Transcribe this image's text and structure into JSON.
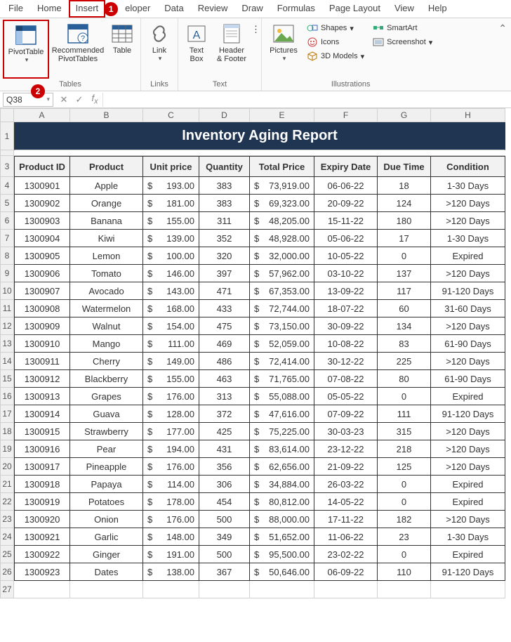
{
  "menu": [
    "File",
    "Home",
    "Insert",
    "Developer",
    "Data",
    "Review",
    "Draw",
    "Formulas",
    "Page Layout",
    "View",
    "Help"
  ],
  "active_menu_index": 2,
  "callouts": {
    "insert": "1",
    "pivot": "2"
  },
  "ribbon": {
    "pivot_table": "PivotTable",
    "recommended": "Recommended\nPivotTables",
    "table": "Table",
    "link": "Link",
    "text_box": "Text\nBox",
    "header_footer": "Header\n& Footer",
    "pictures": "Pictures",
    "shapes": "Shapes",
    "icons": "Icons",
    "models": "3D Models",
    "smartart": "SmartArt",
    "screenshot": "Screenshot",
    "g_tables": "Tables",
    "g_links": "Links",
    "g_text": "Text",
    "g_illust": "Illustrations"
  },
  "namebox": "Q38",
  "formula": "",
  "columns": [
    "A",
    "B",
    "C",
    "D",
    "E",
    "F",
    "G",
    "H"
  ],
  "title": "Inventory Aging Report",
  "headers": [
    "Product ID",
    "Product",
    "Unit price",
    "Quantity",
    "Total Price",
    "Expiry Date",
    "Due Time",
    "Condition"
  ],
  "rows": [
    {
      "id": "1300901",
      "prod": "Apple",
      "unit": "193.00",
      "qty": "383",
      "total": "73,919.00",
      "exp": "06-06-22",
      "due": "18",
      "cond": "1-30 Days"
    },
    {
      "id": "1300902",
      "prod": "Orange",
      "unit": "181.00",
      "qty": "383",
      "total": "69,323.00",
      "exp": "20-09-22",
      "due": "124",
      "cond": ">120 Days"
    },
    {
      "id": "1300903",
      "prod": "Banana",
      "unit": "155.00",
      "qty": "311",
      "total": "48,205.00",
      "exp": "15-11-22",
      "due": "180",
      "cond": ">120 Days"
    },
    {
      "id": "1300904",
      "prod": "Kiwi",
      "unit": "139.00",
      "qty": "352",
      "total": "48,928.00",
      "exp": "05-06-22",
      "due": "17",
      "cond": "1-30 Days"
    },
    {
      "id": "1300905",
      "prod": "Lemon",
      "unit": "100.00",
      "qty": "320",
      "total": "32,000.00",
      "exp": "10-05-22",
      "due": "0",
      "cond": "Expired"
    },
    {
      "id": "1300906",
      "prod": "Tomato",
      "unit": "146.00",
      "qty": "397",
      "total": "57,962.00",
      "exp": "03-10-22",
      "due": "137",
      "cond": ">120 Days"
    },
    {
      "id": "1300907",
      "prod": "Avocado",
      "unit": "143.00",
      "qty": "471",
      "total": "67,353.00",
      "exp": "13-09-22",
      "due": "117",
      "cond": "91-120 Days"
    },
    {
      "id": "1300908",
      "prod": "Watermelon",
      "unit": "168.00",
      "qty": "433",
      "total": "72,744.00",
      "exp": "18-07-22",
      "due": "60",
      "cond": "31-60 Days"
    },
    {
      "id": "1300909",
      "prod": "Walnut",
      "unit": "154.00",
      "qty": "475",
      "total": "73,150.00",
      "exp": "30-09-22",
      "due": "134",
      "cond": ">120 Days"
    },
    {
      "id": "1300910",
      "prod": "Mango",
      "unit": "111.00",
      "qty": "469",
      "total": "52,059.00",
      "exp": "10-08-22",
      "due": "83",
      "cond": "61-90 Days"
    },
    {
      "id": "1300911",
      "prod": "Cherry",
      "unit": "149.00",
      "qty": "486",
      "total": "72,414.00",
      "exp": "30-12-22",
      "due": "225",
      "cond": ">120 Days"
    },
    {
      "id": "1300912",
      "prod": "Blackberry",
      "unit": "155.00",
      "qty": "463",
      "total": "71,765.00",
      "exp": "07-08-22",
      "due": "80",
      "cond": "61-90 Days"
    },
    {
      "id": "1300913",
      "prod": "Grapes",
      "unit": "176.00",
      "qty": "313",
      "total": "55,088.00",
      "exp": "05-05-22",
      "due": "0",
      "cond": "Expired"
    },
    {
      "id": "1300914",
      "prod": "Guava",
      "unit": "128.00",
      "qty": "372",
      "total": "47,616.00",
      "exp": "07-09-22",
      "due": "111",
      "cond": "91-120 Days"
    },
    {
      "id": "1300915",
      "prod": "Strawberry",
      "unit": "177.00",
      "qty": "425",
      "total": "75,225.00",
      "exp": "30-03-23",
      "due": "315",
      "cond": ">120 Days"
    },
    {
      "id": "1300916",
      "prod": "Pear",
      "unit": "194.00",
      "qty": "431",
      "total": "83,614.00",
      "exp": "23-12-22",
      "due": "218",
      "cond": ">120 Days"
    },
    {
      "id": "1300917",
      "prod": "Pineapple",
      "unit": "176.00",
      "qty": "356",
      "total": "62,656.00",
      "exp": "21-09-22",
      "due": "125",
      "cond": ">120 Days"
    },
    {
      "id": "1300918",
      "prod": "Papaya",
      "unit": "114.00",
      "qty": "306",
      "total": "34,884.00",
      "exp": "26-03-22",
      "due": "0",
      "cond": "Expired"
    },
    {
      "id": "1300919",
      "prod": "Potatoes",
      "unit": "178.00",
      "qty": "454",
      "total": "80,812.00",
      "exp": "14-05-22",
      "due": "0",
      "cond": "Expired"
    },
    {
      "id": "1300920",
      "prod": "Onion",
      "unit": "176.00",
      "qty": "500",
      "total": "88,000.00",
      "exp": "17-11-22",
      "due": "182",
      "cond": ">120 Days"
    },
    {
      "id": "1300921",
      "prod": "Garlic",
      "unit": "148.00",
      "qty": "349",
      "total": "51,652.00",
      "exp": "11-06-22",
      "due": "23",
      "cond": "1-30 Days"
    },
    {
      "id": "1300922",
      "prod": "Ginger",
      "unit": "191.00",
      "qty": "500",
      "total": "95,500.00",
      "exp": "23-02-22",
      "due": "0",
      "cond": "Expired"
    },
    {
      "id": "1300923",
      "prod": "Dates",
      "unit": "138.00",
      "qty": "367",
      "total": "50,646.00",
      "exp": "06-09-22",
      "due": "110",
      "cond": "91-120 Days"
    }
  ],
  "row_numbers": [
    "1",
    "",
    "3",
    "4",
    "5",
    "6",
    "7",
    "8",
    "9",
    "10",
    "11",
    "12",
    "13",
    "14",
    "15",
    "16",
    "17",
    "18",
    "19",
    "20",
    "21",
    "22",
    "23",
    "24",
    "25",
    "26",
    "27"
  ]
}
